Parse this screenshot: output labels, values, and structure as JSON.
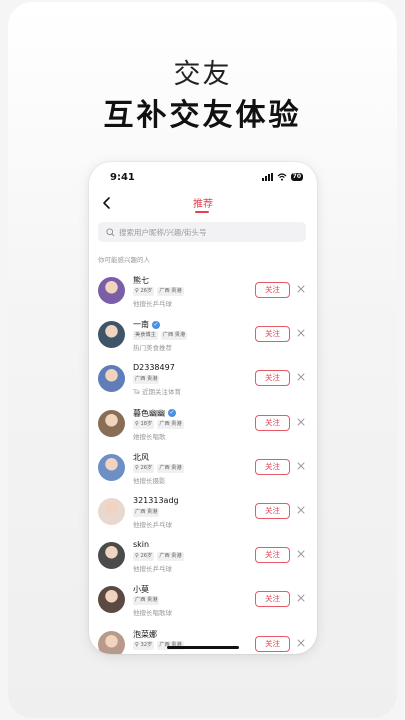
{
  "hero": {
    "subtitle": "交友",
    "title": "互补交友体验"
  },
  "status_bar": {
    "time": "9:41",
    "battery": "70"
  },
  "nav": {
    "title": "推荐"
  },
  "search": {
    "placeholder": "搜索用户昵称/兴趣/街头号"
  },
  "section_label": "你可能感兴趣的人",
  "follow_label": "关注",
  "users": [
    {
      "name": "熊七",
      "verified": false,
      "tags": [
        "♀ 26岁",
        "广西 贵港"
      ],
      "desc": "他擅长乒乓球",
      "avatar_color": "#7b5ea7"
    },
    {
      "name": "一南",
      "verified": true,
      "tags": [
        "美食博主",
        "广西 贵港"
      ],
      "desc": "热门美食推荐",
      "avatar_color": "#3e5569"
    },
    {
      "name": "D2338497",
      "verified": false,
      "tags": [
        "广西 贵港"
      ],
      "desc": "Ta 近期关注体育",
      "avatar_color": "#5f7db8"
    },
    {
      "name": "暮色幽幽",
      "verified": true,
      "tags": [
        "♀ 18岁",
        "广西 贵港"
      ],
      "desc": "她擅长唱歌",
      "avatar_color": "#8a6d55"
    },
    {
      "name": "北风",
      "verified": false,
      "tags": [
        "♀ 26岁",
        "广西 贵港"
      ],
      "desc": "他擅长摄影",
      "avatar_color": "#6c8fc4"
    },
    {
      "name": "321313adg",
      "verified": false,
      "tags": [
        "广西 贵港"
      ],
      "desc": "他擅长乒乓球",
      "avatar_color": "#e9d8cf"
    },
    {
      "name": "skin",
      "verified": false,
      "tags": [
        "♀ 26岁",
        "广西 贵港"
      ],
      "desc": "他擅长乒乓球",
      "avatar_color": "#4b4b4b"
    },
    {
      "name": "小莫",
      "verified": false,
      "tags": [
        "广西 贵港"
      ],
      "desc": "他擅长唱歌球",
      "avatar_color": "#5a4a42"
    },
    {
      "name": "泡菜娜",
      "verified": false,
      "tags": [
        "♀ 32岁",
        "广西 贵港"
      ],
      "desc": "",
      "avatar_color": "#b89a8a"
    }
  ]
}
